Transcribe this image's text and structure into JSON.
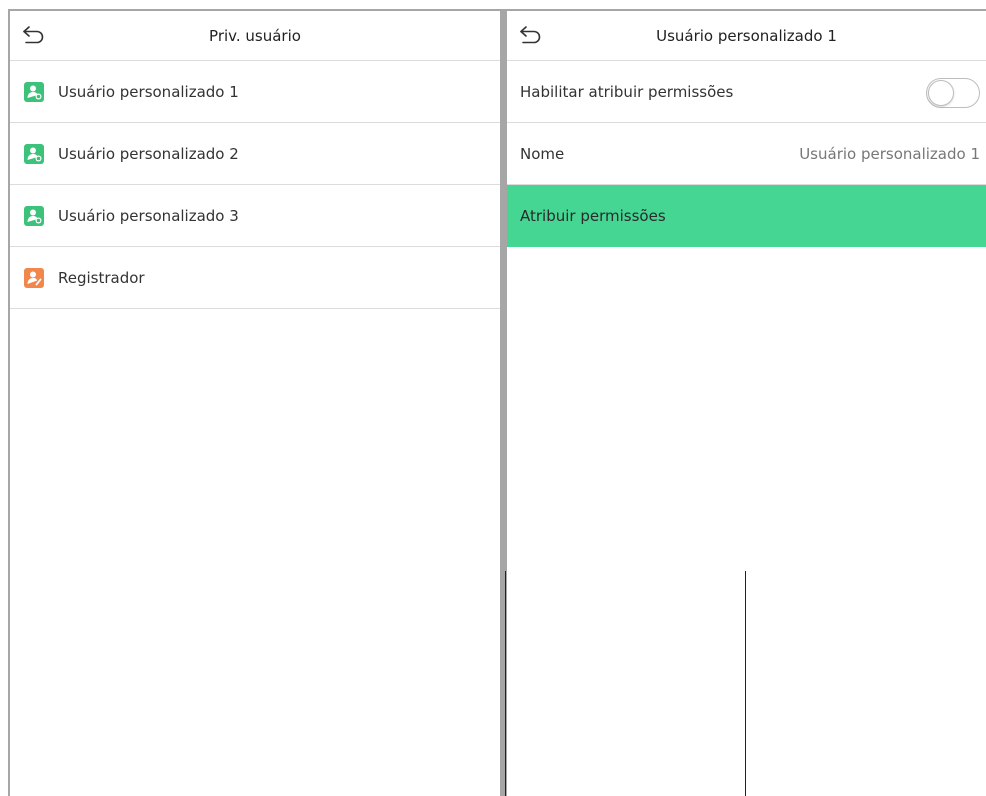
{
  "colors": {
    "accent_green": "#45d694",
    "icon_green": "#3cc27a",
    "icon_orange": "#f2874b",
    "divider": "#a6a6a6"
  },
  "left": {
    "title": "Priv. usuário",
    "back_icon": "back-arrow-icon",
    "items": [
      {
        "label": "Usuário personalizado 1",
        "icon": "custom-user-1-icon"
      },
      {
        "label": "Usuário personalizado 2",
        "icon": "custom-user-2-icon"
      },
      {
        "label": "Usuário personalizado 3",
        "icon": "custom-user-3-icon"
      },
      {
        "label": "Registrador",
        "icon": "registrar-icon"
      }
    ]
  },
  "right": {
    "title": "Usuário personalizado 1",
    "back_icon": "back-arrow-icon",
    "rows": {
      "enable": {
        "label": "Habilitar atribuir permissões",
        "state": "off"
      },
      "name": {
        "label": "Nome",
        "value": "Usuário personalizado 1"
      },
      "assign": {
        "label": "Atribuir permissões",
        "selected": true
      }
    }
  }
}
